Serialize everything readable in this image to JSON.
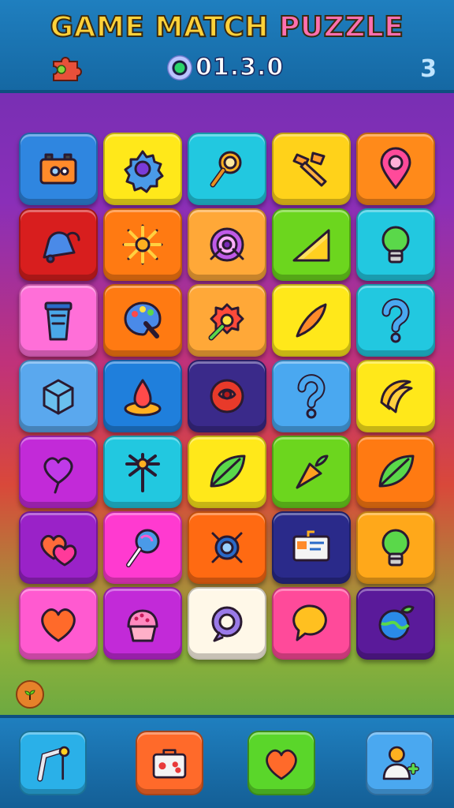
{
  "header": {
    "title_part1": "GAME MATCH ",
    "title_part2": "PUZZLE",
    "version": "01.3.0",
    "level": "3",
    "left_icon": "puzzle-piece-icon"
  },
  "colors": {
    "header_bg": "#1f7fbf",
    "title_yellow": "#ffd23a",
    "title_pink": "#ff6fb0"
  },
  "grid": {
    "rows": 7,
    "cols": 5,
    "tiles": [
      {
        "icon": "battery-icon",
        "color": "#2f86e0"
      },
      {
        "icon": "gear-icon",
        "color": "#ffe81a"
      },
      {
        "icon": "magnifier-gear-icon",
        "color": "#22c8e0"
      },
      {
        "icon": "hammer-icon",
        "color": "#ffd21a"
      },
      {
        "icon": "map-pin-icon",
        "color": "#ff8a1a"
      },
      {
        "icon": "bell-icon",
        "color": "#d81e1e"
      },
      {
        "icon": "sun-icon",
        "color": "#ff7a12"
      },
      {
        "icon": "target-gear-icon",
        "color": "#ffa838"
      },
      {
        "icon": "triangle-ruler-icon",
        "color": "#6cd61e"
      },
      {
        "icon": "lightbulb-icon",
        "color": "#22c8e0"
      },
      {
        "icon": "cup-icon",
        "color": "#ff6fd8"
      },
      {
        "icon": "palette-icon",
        "color": "#ff7a12"
      },
      {
        "icon": "wrench-gear-icon",
        "color": "#ffa838"
      },
      {
        "icon": "feather-icon",
        "color": "#ffe81a"
      },
      {
        "icon": "question-mark-icon",
        "color": "#22c8e0"
      },
      {
        "icon": "box-icon",
        "color": "#5aa8ee"
      },
      {
        "icon": "drop-stand-icon",
        "color": "#1f7fdc"
      },
      {
        "icon": "rose-icon",
        "color": "#3a2a8a"
      },
      {
        "icon": "question-mark-icon",
        "color": "#4aa8f0"
      },
      {
        "icon": "banana-icon",
        "color": "#ffe81a"
      },
      {
        "icon": "heart-balloon-icon",
        "color": "#c22ad8"
      },
      {
        "icon": "pinwheel-icon",
        "color": "#22c8e0"
      },
      {
        "icon": "leaf-icon",
        "color": "#ffe81a"
      },
      {
        "icon": "carrot-icon",
        "color": "#6cd61e"
      },
      {
        "icon": "leaf-icon",
        "color": "#ff7a12"
      },
      {
        "icon": "two-hearts-icon",
        "color": "#9a22c8"
      },
      {
        "icon": "lollipop-icon",
        "color": "#ff3ad0"
      },
      {
        "icon": "bug-gear-icon",
        "color": "#ff6a12"
      },
      {
        "icon": "id-card-icon",
        "color": "#2a2a8a"
      },
      {
        "icon": "lightbulb-icon",
        "color": "#ffa81a"
      },
      {
        "icon": "heart-icon",
        "color": "#ff5ad0"
      },
      {
        "icon": "cupcake-icon",
        "color": "#c22ad8"
      },
      {
        "icon": "ring-icon",
        "color": "#fff8e8"
      },
      {
        "icon": "speech-bubble-icon",
        "color": "#ff4a9a"
      },
      {
        "icon": "globe-leaf-icon",
        "color": "#5a1a9a"
      }
    ]
  },
  "footer": {
    "small_badge_icon": "sprout-icon",
    "buttons": [
      {
        "icon": "crane-icon",
        "color": "#2ab0e8"
      },
      {
        "icon": "suitcase-icon",
        "color": "#ff6a2a"
      },
      {
        "icon": "heart-icon",
        "color": "#5ad62a"
      },
      {
        "icon": "user-add-icon",
        "color": "#4aa8f0"
      }
    ]
  }
}
